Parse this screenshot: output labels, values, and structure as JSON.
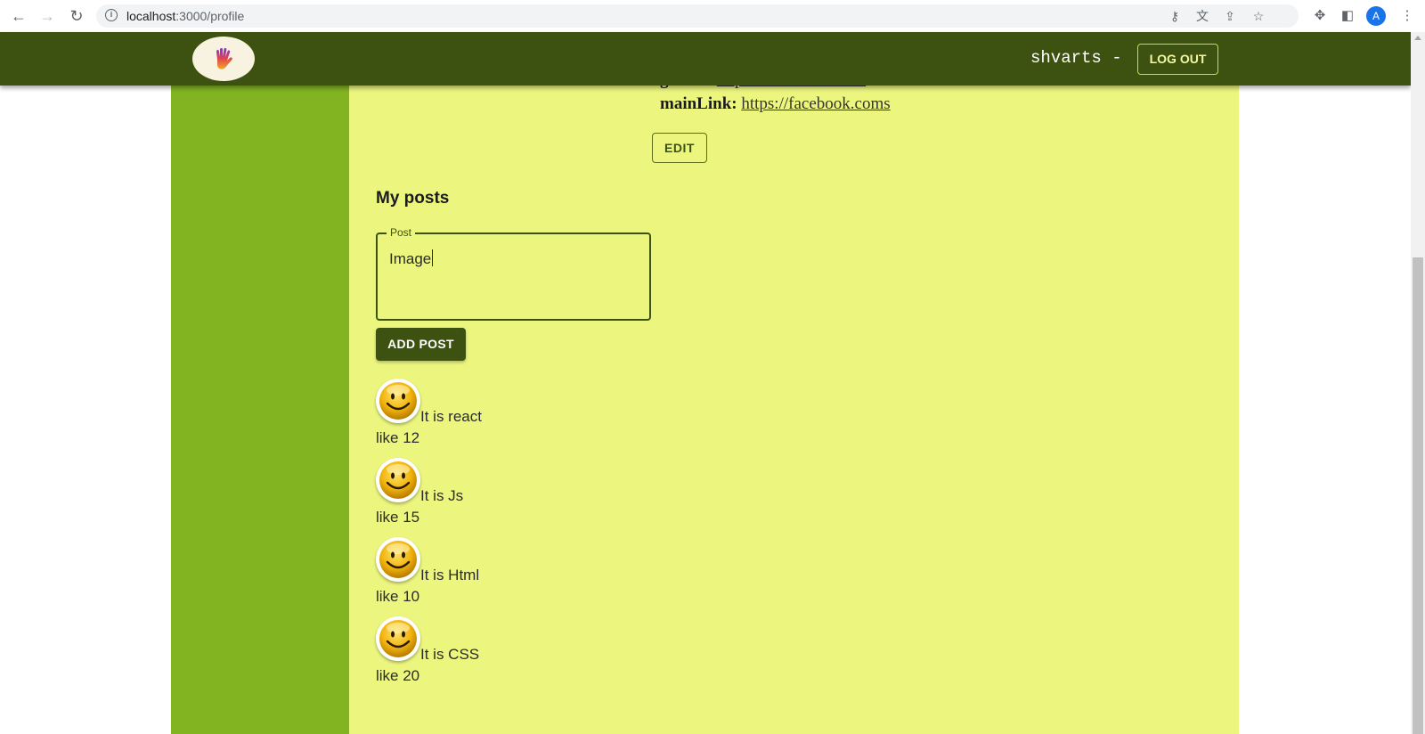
{
  "browser": {
    "url_host": "localhost",
    "url_path": ":3000/profile",
    "profile_initial": "A"
  },
  "header": {
    "username": "shvarts -",
    "logout_label": "LOG OUT"
  },
  "profile": {
    "github_label": "github:",
    "github_link": "https://facebook.coms",
    "mainlink_label": "mainLink:",
    "mainlink_link": "https://facebook.coms",
    "edit_label": "EDIT"
  },
  "posts": {
    "title": "My posts",
    "field_legend": "Post",
    "field_value": "Image",
    "add_label": "ADD POST",
    "items": [
      {
        "message": "It is react",
        "likes": "like 12"
      },
      {
        "message": "It is Js",
        "likes": "like 15"
      },
      {
        "message": "It is Html",
        "likes": "like 10"
      },
      {
        "message": "It is CSS",
        "likes": "like 20"
      }
    ]
  },
  "colors": {
    "header_bg": "#3d5210",
    "sidebar_bg": "#82b421",
    "content_bg": "#ecf67e"
  }
}
